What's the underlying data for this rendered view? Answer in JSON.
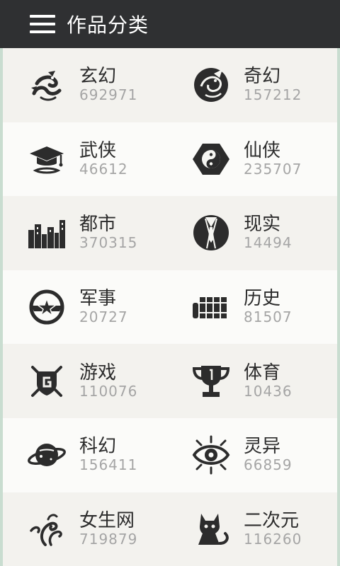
{
  "header": {
    "menu_icon": "hamburger-menu-icon",
    "title": "作品分类"
  },
  "categories": [
    {
      "name": "玄幻",
      "count": "692971",
      "icon": "dragon-icon"
    },
    {
      "name": "奇幻",
      "count": "157212",
      "icon": "winged-dragon-icon"
    },
    {
      "name": "武侠",
      "count": "46612",
      "icon": "scholar-hat-icon"
    },
    {
      "name": "仙侠",
      "count": "235707",
      "icon": "yin-yang-icon"
    },
    {
      "name": "都市",
      "count": "370315",
      "icon": "city-skyline-icon"
    },
    {
      "name": "现实",
      "count": "14494",
      "icon": "suit-tie-icon"
    },
    {
      "name": "军事",
      "count": "20727",
      "icon": "military-star-badge-icon"
    },
    {
      "name": "历史",
      "count": "81507",
      "icon": "bamboo-scroll-icon"
    },
    {
      "name": "游戏",
      "count": "110076",
      "icon": "game-shield-icon"
    },
    {
      "name": "体育",
      "count": "10436",
      "icon": "trophy-icon"
    },
    {
      "name": "科幻",
      "count": "156411",
      "icon": "planet-icon"
    },
    {
      "name": "灵异",
      "count": "66859",
      "icon": "mystic-eye-icon"
    },
    {
      "name": "女生网",
      "count": "719879",
      "icon": "flourish-icon"
    },
    {
      "name": "二次元",
      "count": "116260",
      "icon": "cat-icon"
    }
  ]
}
